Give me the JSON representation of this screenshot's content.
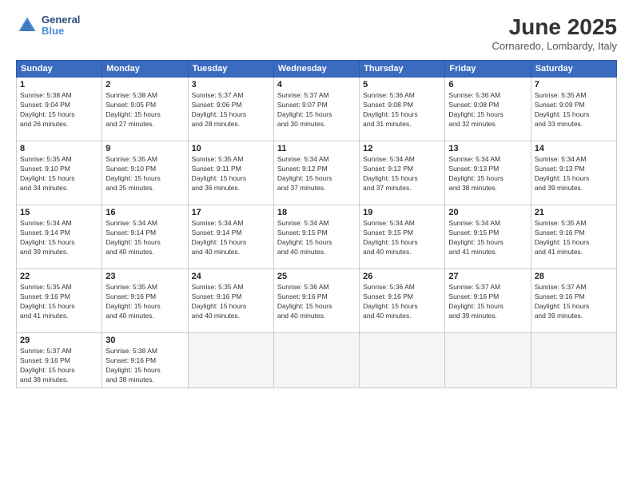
{
  "logo": {
    "line1": "General",
    "line2": "Blue"
  },
  "header": {
    "month": "June 2025",
    "location": "Cornaredo, Lombardy, Italy"
  },
  "weekdays": [
    "Sunday",
    "Monday",
    "Tuesday",
    "Wednesday",
    "Thursday",
    "Friday",
    "Saturday"
  ],
  "weeks": [
    [
      {
        "day": "1",
        "info": "Sunrise: 5:38 AM\nSunset: 9:04 PM\nDaylight: 15 hours\nand 26 minutes."
      },
      {
        "day": "2",
        "info": "Sunrise: 5:38 AM\nSunset: 9:05 PM\nDaylight: 15 hours\nand 27 minutes."
      },
      {
        "day": "3",
        "info": "Sunrise: 5:37 AM\nSunset: 9:06 PM\nDaylight: 15 hours\nand 28 minutes."
      },
      {
        "day": "4",
        "info": "Sunrise: 5:37 AM\nSunset: 9:07 PM\nDaylight: 15 hours\nand 30 minutes."
      },
      {
        "day": "5",
        "info": "Sunrise: 5:36 AM\nSunset: 9:08 PM\nDaylight: 15 hours\nand 31 minutes."
      },
      {
        "day": "6",
        "info": "Sunrise: 5:36 AM\nSunset: 9:08 PM\nDaylight: 15 hours\nand 32 minutes."
      },
      {
        "day": "7",
        "info": "Sunrise: 5:35 AM\nSunset: 9:09 PM\nDaylight: 15 hours\nand 33 minutes."
      }
    ],
    [
      {
        "day": "8",
        "info": "Sunrise: 5:35 AM\nSunset: 9:10 PM\nDaylight: 15 hours\nand 34 minutes."
      },
      {
        "day": "9",
        "info": "Sunrise: 5:35 AM\nSunset: 9:10 PM\nDaylight: 15 hours\nand 35 minutes."
      },
      {
        "day": "10",
        "info": "Sunrise: 5:35 AM\nSunset: 9:11 PM\nDaylight: 15 hours\nand 36 minutes."
      },
      {
        "day": "11",
        "info": "Sunrise: 5:34 AM\nSunset: 9:12 PM\nDaylight: 15 hours\nand 37 minutes."
      },
      {
        "day": "12",
        "info": "Sunrise: 5:34 AM\nSunset: 9:12 PM\nDaylight: 15 hours\nand 37 minutes."
      },
      {
        "day": "13",
        "info": "Sunrise: 5:34 AM\nSunset: 9:13 PM\nDaylight: 15 hours\nand 38 minutes."
      },
      {
        "day": "14",
        "info": "Sunrise: 5:34 AM\nSunset: 9:13 PM\nDaylight: 15 hours\nand 39 minutes."
      }
    ],
    [
      {
        "day": "15",
        "info": "Sunrise: 5:34 AM\nSunset: 9:14 PM\nDaylight: 15 hours\nand 39 minutes."
      },
      {
        "day": "16",
        "info": "Sunrise: 5:34 AM\nSunset: 9:14 PM\nDaylight: 15 hours\nand 40 minutes."
      },
      {
        "day": "17",
        "info": "Sunrise: 5:34 AM\nSunset: 9:14 PM\nDaylight: 15 hours\nand 40 minutes."
      },
      {
        "day": "18",
        "info": "Sunrise: 5:34 AM\nSunset: 9:15 PM\nDaylight: 15 hours\nand 40 minutes."
      },
      {
        "day": "19",
        "info": "Sunrise: 5:34 AM\nSunset: 9:15 PM\nDaylight: 15 hours\nand 40 minutes."
      },
      {
        "day": "20",
        "info": "Sunrise: 5:34 AM\nSunset: 9:15 PM\nDaylight: 15 hours\nand 41 minutes."
      },
      {
        "day": "21",
        "info": "Sunrise: 5:35 AM\nSunset: 9:16 PM\nDaylight: 15 hours\nand 41 minutes."
      }
    ],
    [
      {
        "day": "22",
        "info": "Sunrise: 5:35 AM\nSunset: 9:16 PM\nDaylight: 15 hours\nand 41 minutes."
      },
      {
        "day": "23",
        "info": "Sunrise: 5:35 AM\nSunset: 9:16 PM\nDaylight: 15 hours\nand 40 minutes."
      },
      {
        "day": "24",
        "info": "Sunrise: 5:35 AM\nSunset: 9:16 PM\nDaylight: 15 hours\nand 40 minutes."
      },
      {
        "day": "25",
        "info": "Sunrise: 5:36 AM\nSunset: 9:16 PM\nDaylight: 15 hours\nand 40 minutes."
      },
      {
        "day": "26",
        "info": "Sunrise: 5:36 AM\nSunset: 9:16 PM\nDaylight: 15 hours\nand 40 minutes."
      },
      {
        "day": "27",
        "info": "Sunrise: 5:37 AM\nSunset: 9:16 PM\nDaylight: 15 hours\nand 39 minutes."
      },
      {
        "day": "28",
        "info": "Sunrise: 5:37 AM\nSunset: 9:16 PM\nDaylight: 15 hours\nand 39 minutes."
      }
    ],
    [
      {
        "day": "29",
        "info": "Sunrise: 5:37 AM\nSunset: 9:16 PM\nDaylight: 15 hours\nand 38 minutes."
      },
      {
        "day": "30",
        "info": "Sunrise: 5:38 AM\nSunset: 9:16 PM\nDaylight: 15 hours\nand 38 minutes."
      },
      {
        "day": "",
        "info": ""
      },
      {
        "day": "",
        "info": ""
      },
      {
        "day": "",
        "info": ""
      },
      {
        "day": "",
        "info": ""
      },
      {
        "day": "",
        "info": ""
      }
    ]
  ]
}
